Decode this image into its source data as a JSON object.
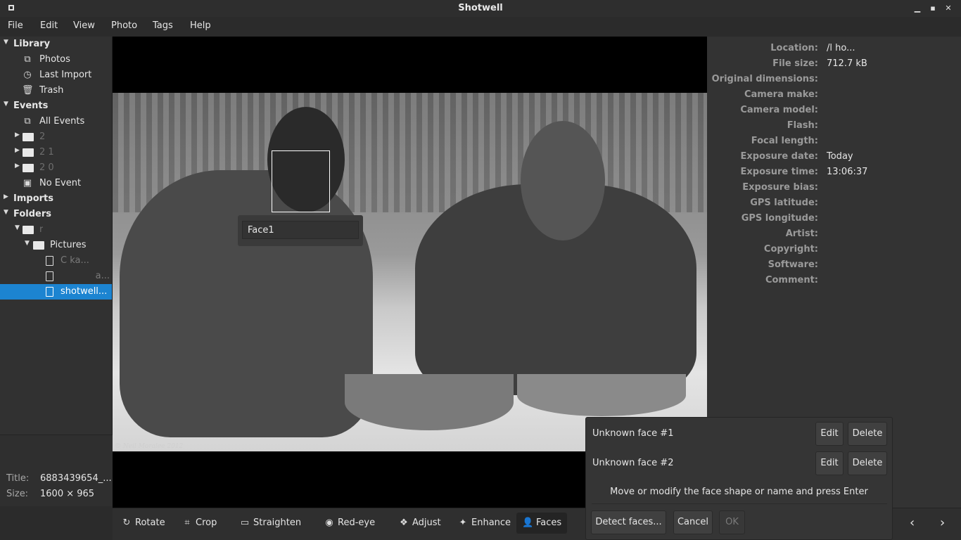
{
  "window": {
    "title": "Shotwell"
  },
  "menu": [
    "File",
    "Edit",
    "View",
    "Photo",
    "Tags",
    "Help"
  ],
  "sidebar": {
    "library": {
      "label": "Library",
      "items": [
        "Photos",
        "Last Import",
        "Trash"
      ]
    },
    "events": {
      "label": "Events",
      "all": "All Events",
      "years": [
        "2",
        "2 1",
        "2 0"
      ],
      "no_event": "No Event"
    },
    "imports": {
      "label": "Imports"
    },
    "folders": {
      "label": "Folders",
      "root": "r",
      "pictures": "Pictures",
      "files": [
        "C  ka...",
        "a...",
        "shotwell..."
      ]
    }
  },
  "side_info": {
    "title_label": "Title:",
    "title_value": "6883439654_...",
    "size_label": "Size:",
    "size_value": "1600 × 965"
  },
  "photo": {
    "watermark": "© Neil Moralee 2012",
    "face_label": "Face1"
  },
  "metadata": [
    {
      "k": "Location:",
      "v": "/l                                          ho..."
    },
    {
      "k": "File size:",
      "v": "712.7 kB"
    },
    {
      "k": "Original dimensions:",
      "v": ""
    },
    {
      "k": "Camera make:",
      "v": ""
    },
    {
      "k": "Camera model:",
      "v": ""
    },
    {
      "k": "Flash:",
      "v": ""
    },
    {
      "k": "Focal length:",
      "v": ""
    },
    {
      "k": "Exposure date:",
      "v": "Today"
    },
    {
      "k": "Exposure time:",
      "v": "13:06:37"
    },
    {
      "k": "Exposure bias:",
      "v": ""
    },
    {
      "k": "GPS latitude:",
      "v": ""
    },
    {
      "k": "GPS longitude:",
      "v": ""
    },
    {
      "k": "Artist:",
      "v": ""
    },
    {
      "k": "Copyright:",
      "v": ""
    },
    {
      "k": "Software:",
      "v": ""
    },
    {
      "k": "Comment:",
      "v": ""
    }
  ],
  "toolbar": {
    "rotate": "Rotate",
    "crop": "Crop",
    "straighten": "Straighten",
    "redeye": "Red-eye",
    "adjust": "Adjust",
    "enhance": "Enhance",
    "faces": "Faces"
  },
  "faces_popup": {
    "faces": [
      {
        "name": "Unknown face #1",
        "edit": "Edit",
        "delete": "Delete"
      },
      {
        "name": "Unknown face #2",
        "edit": "Edit",
        "delete": "Delete"
      }
    ],
    "hint": "Move or modify the face shape or name and press Enter",
    "detect": "Detect faces...",
    "cancel": "Cancel",
    "ok": "OK"
  },
  "colors": {
    "selection": "#1c84d1",
    "background": "#2b2b2b"
  },
  "icons": {
    "prev": "chevron-left-icon",
    "next": "chevron-right-icon"
  }
}
